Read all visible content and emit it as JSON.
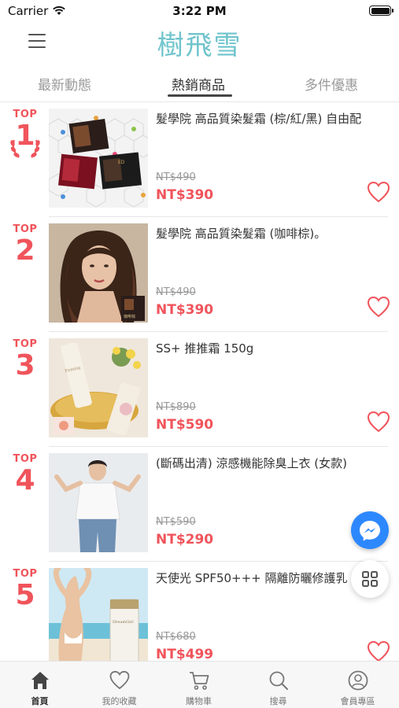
{
  "status": {
    "carrier": "Carrier",
    "time": "3:22 PM"
  },
  "header": {
    "logo": "樹飛雪"
  },
  "tabs": [
    {
      "label": "最新動態"
    },
    {
      "label": "熱銷商品",
      "active": true
    },
    {
      "label": "多件優惠"
    }
  ],
  "products": [
    {
      "rank_label": "TOP",
      "rank": "1",
      "title": "髮學院 高品質染髮霜 (棕/紅/黑) 自由配",
      "old_price": "NT$490",
      "price": "NT$390"
    },
    {
      "rank_label": "TOP",
      "rank": "2",
      "title": "髮學院 高品質染髮霜 (咖啡棕)。",
      "old_price": "NT$490",
      "price": "NT$390"
    },
    {
      "rank_label": "TOP",
      "rank": "3",
      "title": "SS+ 推推霜 150g",
      "old_price": "NT$890",
      "price": "NT$590"
    },
    {
      "rank_label": "TOP",
      "rank": "4",
      "title": "(斷碼出清) 涼感機能除臭上衣 (女款)",
      "old_price": "NT$590",
      "price": "NT$290"
    },
    {
      "rank_label": "TOP",
      "rank": "5",
      "title": "天使光 SPF50+++ 隔離防曬修護乳",
      "old_price": "NT$680",
      "price": "NT$499"
    }
  ],
  "bottom_nav": [
    {
      "label": "首頁",
      "icon": "home-icon",
      "active": true
    },
    {
      "label": "我的收藏",
      "icon": "heart-icon"
    },
    {
      "label": "購物車",
      "icon": "cart-icon"
    },
    {
      "label": "搜尋",
      "icon": "search-icon"
    },
    {
      "label": "會員專區",
      "icon": "user-icon"
    }
  ],
  "colors": {
    "accent": "#f0545b",
    "logo": "#6fc4cc",
    "messenger": "#2d88ff"
  }
}
